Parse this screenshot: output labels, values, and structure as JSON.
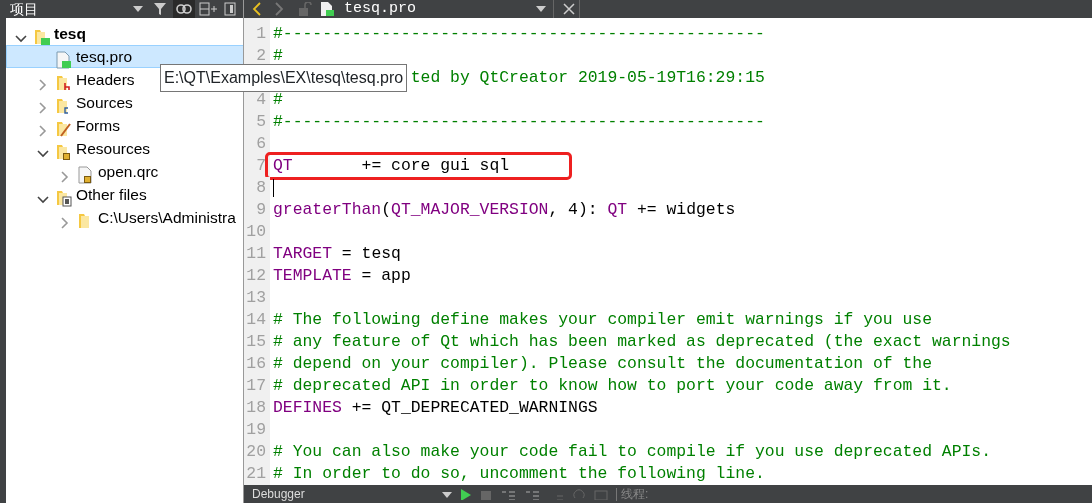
{
  "sidebar": {
    "title": "项目",
    "tree": [
      {
        "label": "tesq",
        "kind": "project",
        "bold": true,
        "expanded": true,
        "selected": false,
        "children": [
          {
            "label": "tesq.pro",
            "kind": "pro",
            "selected": true
          },
          {
            "label": "Headers",
            "kind": "headers",
            "expanded": false,
            "selected": false
          },
          {
            "label": "Sources",
            "kind": "sources",
            "expanded": false,
            "selected": false
          },
          {
            "label": "Forms",
            "kind": "forms",
            "expanded": false,
            "selected": false
          },
          {
            "label": "Resources",
            "kind": "resources",
            "expanded": true,
            "selected": false,
            "children": [
              {
                "label": "open.qrc",
                "kind": "qrc",
                "expanded": false,
                "selected": false
              }
            ]
          },
          {
            "label": "Other files",
            "kind": "other",
            "expanded": true,
            "selected": false,
            "children": [
              {
                "label": "C:\\Users\\Administra",
                "kind": "folder",
                "expanded": false,
                "selected": false
              }
            ]
          }
        ]
      }
    ]
  },
  "tooltip": "E:\\QT\\Examples\\EX\\tesq\\tesq.pro",
  "editor": {
    "file_name": "tesq.pro",
    "lines": [
      {
        "number": "1",
        "segments": [
          {
            "kind": "comment",
            "text": "#-------------------------------------------------"
          }
        ]
      },
      {
        "number": "2",
        "segments": [
          {
            "kind": "comment",
            "text": "#"
          }
        ]
      },
      {
        "covered": true,
        "segments": [
          {
            "kind": "comment",
            "text": "ted by QtCreator 2019-05-19T16:29:15"
          }
        ]
      },
      {
        "number": "4",
        "segments": [
          {
            "kind": "comment",
            "text": "#"
          }
        ]
      },
      {
        "number": "5",
        "segments": [
          {
            "kind": "comment",
            "text": "#-------------------------------------------------"
          }
        ]
      },
      {
        "number": "6"
      },
      {
        "number": "7",
        "highlighted": true,
        "segments": [
          {
            "kind": "variable",
            "text": "QT"
          },
          {
            "kind": "plain",
            "text": "       += core gui sql"
          }
        ]
      },
      {
        "number": "8",
        "cursor": true
      },
      {
        "number": "9",
        "segments": [
          {
            "kind": "variable",
            "text": "greaterThan"
          },
          {
            "kind": "plain",
            "text": "("
          },
          {
            "kind": "variable",
            "text": "QT_MAJOR_VERSION"
          },
          {
            "kind": "plain",
            "text": ", 4): "
          },
          {
            "kind": "variable",
            "text": "QT"
          },
          {
            "kind": "plain",
            "text": " += widgets"
          }
        ]
      },
      {
        "number": "10"
      },
      {
        "number": "11",
        "segments": [
          {
            "kind": "variable",
            "text": "TARGET"
          },
          {
            "kind": "plain",
            "text": " = tesq"
          }
        ]
      },
      {
        "number": "12",
        "segments": [
          {
            "kind": "variable",
            "text": "TEMPLATE"
          },
          {
            "kind": "plain",
            "text": " = app"
          }
        ]
      },
      {
        "number": "13"
      },
      {
        "number": "14",
        "segments": [
          {
            "kind": "comment",
            "text": "# The following define makes your compiler emit warnings if you use"
          }
        ]
      },
      {
        "number": "15",
        "segments": [
          {
            "kind": "comment",
            "text": "# any feature of Qt which has been marked as deprecated (the exact warnings"
          }
        ]
      },
      {
        "number": "16",
        "segments": [
          {
            "kind": "comment",
            "text": "# depend on your compiler). Please consult the documentation of the"
          }
        ]
      },
      {
        "number": "17",
        "segments": [
          {
            "kind": "comment",
            "text": "# deprecated API in order to know how to port your code away from it."
          }
        ]
      },
      {
        "number": "18",
        "segments": [
          {
            "kind": "variable",
            "text": "DEFINES"
          },
          {
            "kind": "plain",
            "text": " += QT_DEPRECATED_WARNINGS"
          }
        ]
      },
      {
        "number": "19"
      },
      {
        "number": "20",
        "segments": [
          {
            "kind": "comment",
            "text": "# You can also make your code fail to compile if you use deprecated APIs."
          }
        ]
      },
      {
        "number": "21",
        "segments": [
          {
            "kind": "comment",
            "text": "# In order to do so, uncomment the following line."
          }
        ]
      }
    ]
  },
  "bottom_bar": {
    "debugger": "Debugger",
    "thread_label": "线程:"
  }
}
